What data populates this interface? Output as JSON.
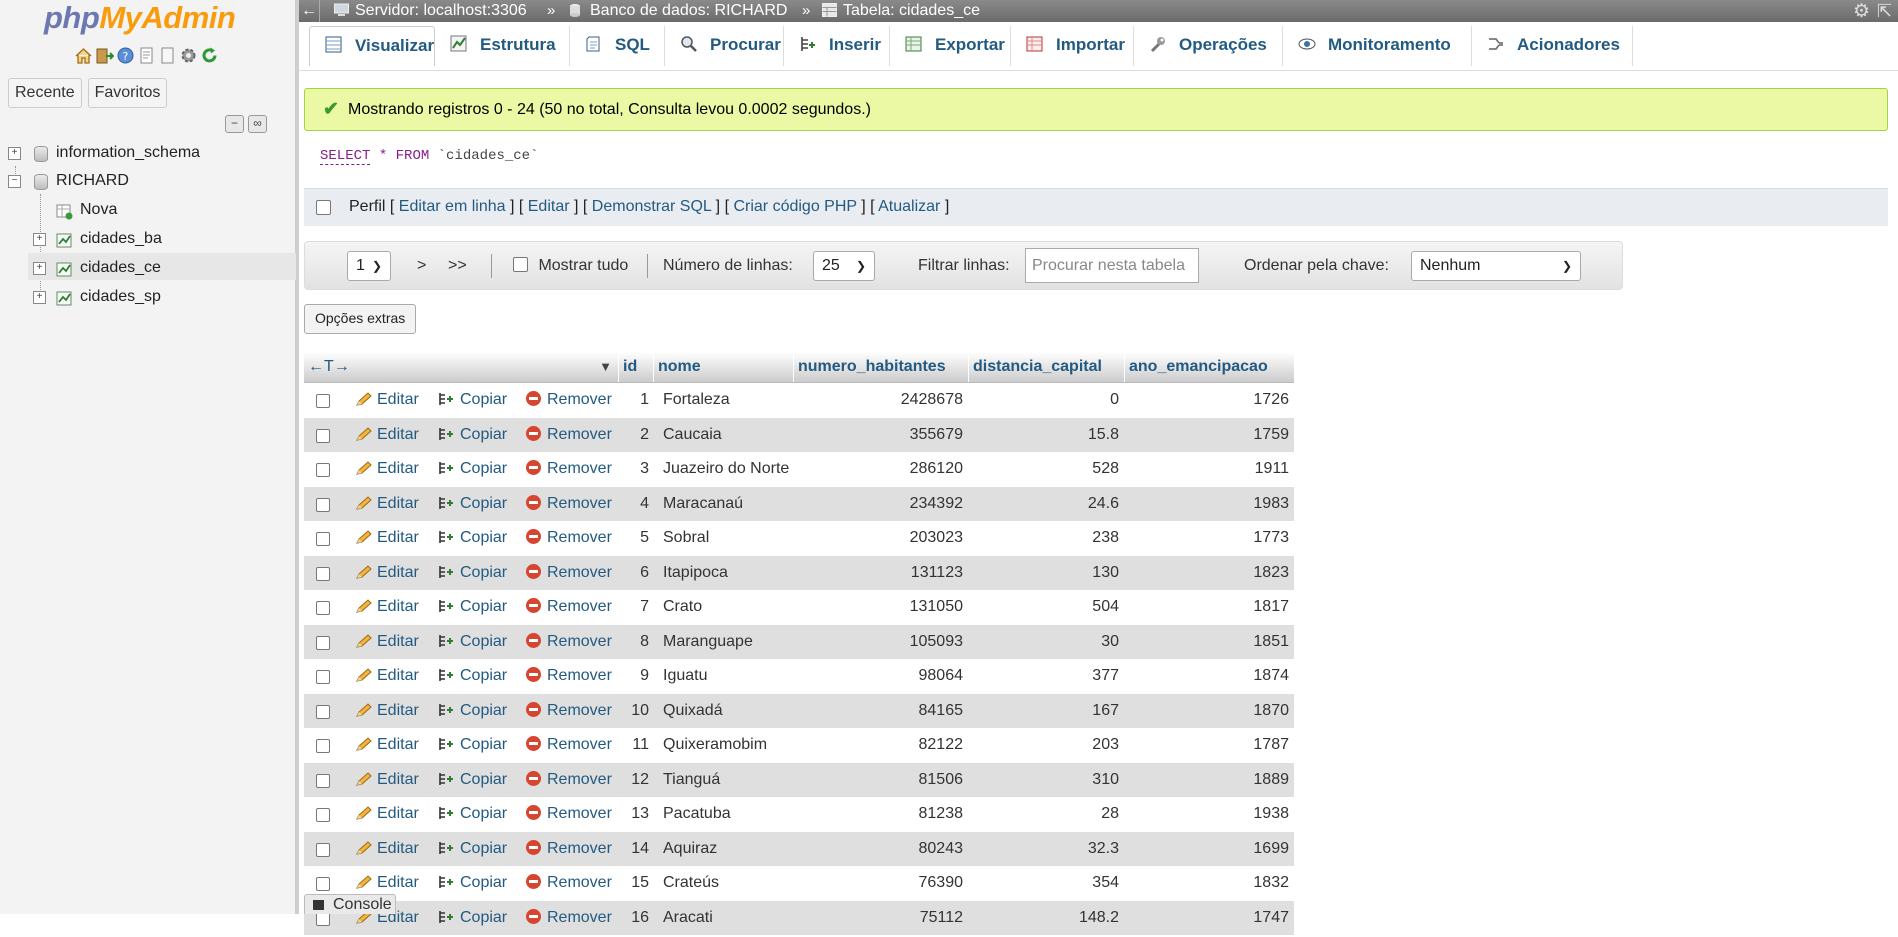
{
  "logo": {
    "part1": "php",
    "part2": "MyAdmin"
  },
  "nav": {
    "recent_label": "Recente",
    "favorites_label": "Favoritos",
    "tree": [
      {
        "label": "information_schema",
        "type": "db"
      },
      {
        "label": "RICHARD",
        "type": "db"
      },
      {
        "label": "Nova",
        "type": "new"
      },
      {
        "label": "cidades_ba",
        "type": "table"
      },
      {
        "label": "cidades_ce",
        "type": "table",
        "selected": true
      },
      {
        "label": "cidades_sp",
        "type": "table"
      }
    ]
  },
  "breadcrumb": {
    "server": "Servidor: localhost:3306",
    "database": "Banco de dados: RICHARD",
    "table": "Tabela: cidades_ce",
    "separator": "»"
  },
  "tabs": [
    {
      "label": "Visualizar",
      "icon": "browse-icon",
      "active": true
    },
    {
      "label": "Estrutura",
      "icon": "structure-icon"
    },
    {
      "label": "SQL",
      "icon": "sql-icon"
    },
    {
      "label": "Procurar",
      "icon": "search-icon"
    },
    {
      "label": "Inserir",
      "icon": "insert-icon"
    },
    {
      "label": "Exportar",
      "icon": "export-icon"
    },
    {
      "label": "Importar",
      "icon": "import-icon"
    },
    {
      "label": "Operações",
      "icon": "wrench-icon"
    },
    {
      "label": "Monitoramento",
      "icon": "eye-icon"
    },
    {
      "label": "Acionadores",
      "icon": "triggers-icon"
    }
  ],
  "message": "Mostrando registros 0 - 24 (50 no total, Consulta levou 0.0002 segundos.)",
  "query": {
    "select": "SELECT",
    "star": "*",
    "from": "FROM",
    "table": "`cidades_ce`"
  },
  "actions": {
    "profile": "Perfil",
    "inline_edit": "Editar em linha",
    "edit": "Editar",
    "explain": "Demonstrar SQL",
    "php_code": "Criar código PHP",
    "refresh": "Atualizar"
  },
  "pagination": {
    "page": "1",
    "next": ">",
    "last": ">>",
    "show_all": "Mostrar tudo",
    "rows_label": "Número de linhas:",
    "rows_value": "25",
    "filter_label": "Filtrar linhas:",
    "filter_placeholder": "Procurar nesta tabela",
    "sort_label": "Ordenar pela chave:",
    "sort_value": "Nenhum"
  },
  "extra_options": "Opções extras",
  "columns": [
    "id",
    "nome",
    "numero_habitantes",
    "distancia_capital",
    "ano_emancipacao"
  ],
  "row_actions": {
    "edit": "Editar",
    "copy": "Copiar",
    "remove": "Remover"
  },
  "rows": [
    {
      "id": "1",
      "nome": "Fortaleza",
      "numero_habitantes": "2428678",
      "distancia_capital": "0",
      "ano_emancipacao": "1726"
    },
    {
      "id": "2",
      "nome": "Caucaia",
      "numero_habitantes": "355679",
      "distancia_capital": "15.8",
      "ano_emancipacao": "1759"
    },
    {
      "id": "3",
      "nome": "Juazeiro do Norte",
      "numero_habitantes": "286120",
      "distancia_capital": "528",
      "ano_emancipacao": "1911"
    },
    {
      "id": "4",
      "nome": "Maracanaú",
      "numero_habitantes": "234392",
      "distancia_capital": "24.6",
      "ano_emancipacao": "1983"
    },
    {
      "id": "5",
      "nome": "Sobral",
      "numero_habitantes": "203023",
      "distancia_capital": "238",
      "ano_emancipacao": "1773"
    },
    {
      "id": "6",
      "nome": "Itapipoca",
      "numero_habitantes": "131123",
      "distancia_capital": "130",
      "ano_emancipacao": "1823"
    },
    {
      "id": "7",
      "nome": "Crato",
      "numero_habitantes": "131050",
      "distancia_capital": "504",
      "ano_emancipacao": "1817"
    },
    {
      "id": "8",
      "nome": "Maranguape",
      "numero_habitantes": "105093",
      "distancia_capital": "30",
      "ano_emancipacao": "1851"
    },
    {
      "id": "9",
      "nome": "Iguatu",
      "numero_habitantes": "98064",
      "distancia_capital": "377",
      "ano_emancipacao": "1874"
    },
    {
      "id": "10",
      "nome": "Quixadá",
      "numero_habitantes": "84165",
      "distancia_capital": "167",
      "ano_emancipacao": "1870"
    },
    {
      "id": "11",
      "nome": "Quixeramobim",
      "numero_habitantes": "82122",
      "distancia_capital": "203",
      "ano_emancipacao": "1787"
    },
    {
      "id": "12",
      "nome": "Tianguá",
      "numero_habitantes": "81506",
      "distancia_capital": "310",
      "ano_emancipacao": "1889"
    },
    {
      "id": "13",
      "nome": "Pacatuba",
      "numero_habitantes": "81238",
      "distancia_capital": "28",
      "ano_emancipacao": "1938"
    },
    {
      "id": "14",
      "nome": "Aquiraz",
      "numero_habitantes": "80243",
      "distancia_capital": "32.3",
      "ano_emancipacao": "1699"
    },
    {
      "id": "15",
      "nome": "Crateús",
      "numero_habitantes": "76390",
      "distancia_capital": "354",
      "ano_emancipacao": "1832"
    },
    {
      "id": "16",
      "nome": "Aracati",
      "numero_habitantes": "75112",
      "distancia_capital": "148.2",
      "ano_emancipacao": "1747"
    }
  ],
  "console_label": "Console"
}
